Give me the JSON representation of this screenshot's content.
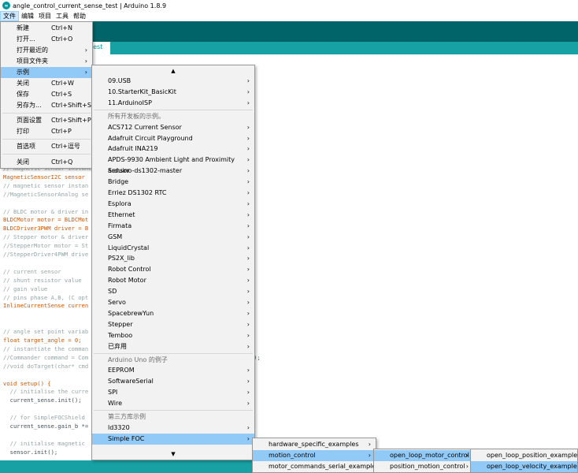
{
  "window": {
    "title": "angle_control_current_sense_test | Arduino 1.8.9",
    "icon": "arduino-logo-icon"
  },
  "menubar": {
    "items": [
      "文件",
      "编辑",
      "项目",
      "工具",
      "帮助"
    ],
    "active": "文件"
  },
  "tab": {
    "label": "test"
  },
  "file_menu": {
    "items": [
      {
        "label": "新建",
        "shortcut": "Ctrl+N"
      },
      {
        "label": "打开...",
        "shortcut": "Ctrl+O"
      },
      {
        "label": "打开最近的",
        "shortcut": ""
      },
      {
        "label": "项目文件夹",
        "shortcut": ""
      },
      {
        "label": "示例",
        "shortcut": ""
      },
      {
        "label": "关闭",
        "shortcut": "Ctrl+W"
      },
      {
        "label": "保存",
        "shortcut": "Ctrl+S"
      },
      {
        "label": "另存为...",
        "shortcut": "Ctrl+Shift+S"
      },
      {
        "label": "页面设置",
        "shortcut": "Ctrl+Shift+P"
      },
      {
        "label": "打印",
        "shortcut": "Ctrl+P"
      },
      {
        "label": "首选项",
        "shortcut": "Ctrl+逗号"
      },
      {
        "label": "关闭",
        "shortcut": "Ctrl+Q"
      }
    ]
  },
  "examples_menu": {
    "scroll_up": "▲",
    "scroll_down": "▼",
    "builtin": [
      "09.USB",
      "10.StarterKit_BasicKit",
      "11.ArduinoISP"
    ],
    "all_boards_header": "所有开发板的示例。",
    "all_boards": [
      "ACS712 Current Sensor",
      "Adafruit Circuit Playground",
      "Adafruit INA219",
      "APDS-9930 Ambient Light and Proximity Sensor",
      "arduino-ds1302-master",
      "Bridge",
      "Erriez DS1302 RTC",
      "Esplora",
      "Ethernet",
      "Firmata",
      "GSM",
      "LiquidCrystal",
      "PS2X_lib",
      "Robot Control",
      "Robot Motor",
      "SD",
      "Servo",
      "SpacebrewYun",
      "Stepper",
      "Temboo",
      "已弃用"
    ],
    "uno_header": "Arduino Uno 的例子",
    "uno": [
      "EEPROM",
      "SoftwareSerial",
      "SPI",
      "Wire"
    ],
    "third_party_header": "第三方库示例",
    "third_party": [
      "ld3320",
      "Simple FOC"
    ]
  },
  "simplefoc_menu": {
    "items": [
      "hardware_specific_examples",
      "motion_control",
      "motor_commands_serial_examples"
    ]
  },
  "motion_control_menu": {
    "items": [
      "open_loop_motor_control",
      "position_motion_control"
    ]
  },
  "open_loop_menu": {
    "items": [
      "open_loop_position_example",
      "open_loop_velocity_example"
    ]
  },
  "code": [
    "// magnetic sensor instance",
    "MagneticSensorI2C sensor",
    "// magnetic sensor instan",
    "//MagneticSensorAnalog se",
    "",
    "// BLDC motor & driver in",
    "BLDCMotor motor = BLDCMot",
    "BLDCDriver3PWM driver = B",
    "// Stepper motor & driver",
    "//StepperMotor motor = St",
    "//StepperDriver4PWM drive",
    "",
    "// current sensor",
    "// shunt resistor value",
    "// gain value",
    "// pins phase A,B, (C opt",
    "InlineCurrentSense curren",
    "",
    "",
    "// angle set point variab",
    "float target_angle = 0;",
    "// instantiate the comman",
    "//Commander command = Com",
    "//void doTarget(char* cmd",
    "",
    "void setup() {",
    "  // initialise the curre",
    "  current_sense.init();",
    "",
    "  // for SimpleFOCShield",
    "  current_sense.gain_b *=",
    "",
    "  // initialise magnetic",
    "  sensor.init();"
  ],
  "code_tail": ");"
}
